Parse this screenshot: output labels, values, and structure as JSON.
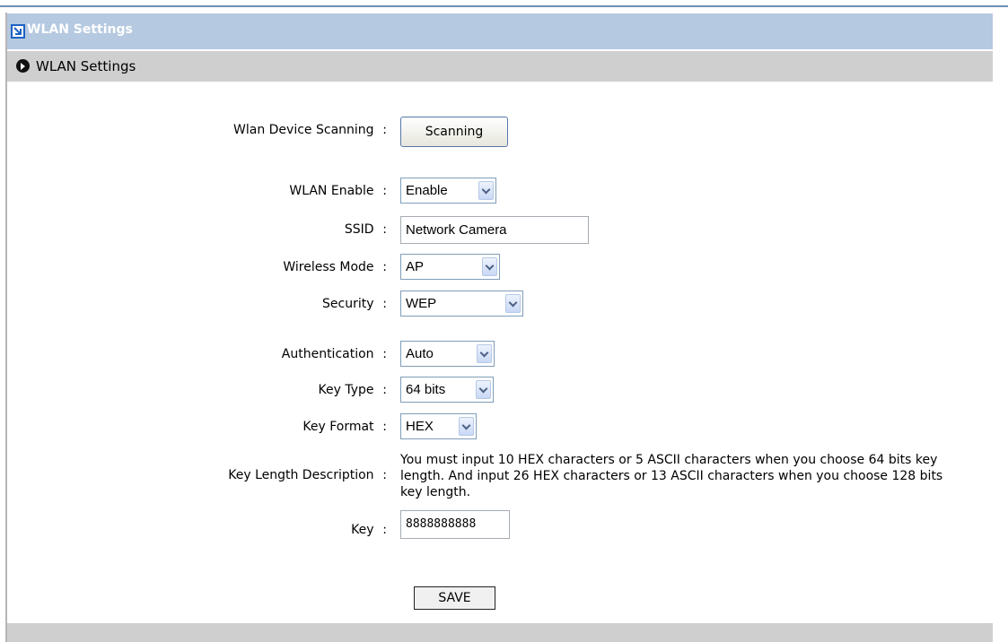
{
  "title_bar": {
    "title": "WLAN Settings"
  },
  "section": {
    "title": "WLAN Settings"
  },
  "form": {
    "scanning_label": "Wlan Device Scanning",
    "scanning_button": "Scanning",
    "wlan_enable_label": "WLAN Enable",
    "wlan_enable_value": "Enable",
    "ssid_label": "SSID",
    "ssid_value": "Network Camera",
    "wireless_mode_label": "Wireless Mode",
    "wireless_mode_value": "AP",
    "security_label": "Security",
    "security_value": "WEP",
    "authentication_label": "Authentication",
    "authentication_value": "Auto",
    "key_type_label": "Key Type",
    "key_type_value": "64 bits",
    "key_format_label": "Key Format",
    "key_format_value": "HEX",
    "key_length_desc_label": "Key Length Description",
    "key_length_desc_text": "You must input 10 HEX characters or 5 ASCII characters when you choose 64 bits key length. And input 26 HEX characters or 13 ASCII characters when you choose 128 bits key length.",
    "key_label": "Key",
    "key_value": "8888888888",
    "colon": ":",
    "save_button": "SAVE"
  },
  "colors": {
    "title_bar_bg": "#b5c9e0",
    "section_bar_bg": "#cfcfcf",
    "select_border": "#7f9db9",
    "scan_button_border": "#5577aa"
  },
  "icons": {
    "title_icon": "arrow-box-icon",
    "section_icon": "play-circle-icon",
    "dropdown_icon": "chevron-down-icon"
  }
}
